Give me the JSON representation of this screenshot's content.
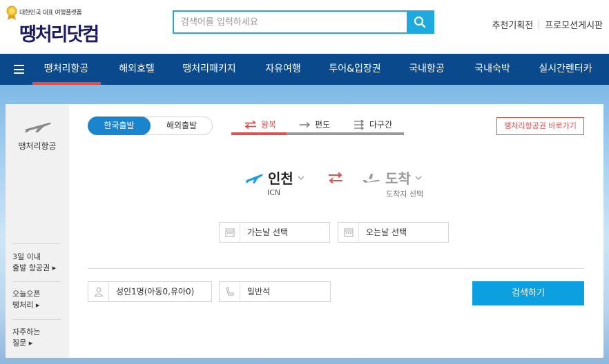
{
  "header": {
    "tagline": "대한민국 대표 여행플랫폼",
    "brand": "땡처리닷컴",
    "search_placeholder": "검색어를 입력하세요",
    "links": [
      "추천기획전",
      "프로모션게시판"
    ]
  },
  "nav": {
    "items": [
      "땡처리항공",
      "해외호텔",
      "땡처리패키지",
      "자유여행",
      "투어&입장권",
      "국내항공",
      "국내숙박",
      "실시간렌터카"
    ],
    "active": "땡처리항공"
  },
  "sidebar": {
    "title": "땡처리항공",
    "links": [
      {
        "line1": "3일 이내",
        "line2": "출발 항공권 ▸"
      },
      {
        "line1": "오늘오픈",
        "line2": "땡처리 ▸"
      },
      {
        "line1": "자주하는",
        "line2": "질문 ▸"
      }
    ]
  },
  "booking": {
    "departure_tabs": {
      "active": "한국출발",
      "inactive": "해외출발"
    },
    "trip_types": [
      "왕복",
      "편도",
      "다구간"
    ],
    "active_trip": "왕복",
    "shortcut_button": "땡처리항공권 바로가기",
    "origin": {
      "city": "인천",
      "code": "ICN"
    },
    "destination": {
      "city": "도착",
      "hint": "도착지 선택"
    },
    "depart_date": "가는날 선택",
    "return_date": "오는날 선택",
    "passengers": "성인1명(아동0,유아0)",
    "cabin": "일반석",
    "search_button": "검색하기"
  },
  "colors": {
    "nav_bg": "#0a4a8c",
    "accent_blue": "#1a84cc",
    "search_blue": "#0da0e0",
    "accent_red": "#e05050"
  }
}
